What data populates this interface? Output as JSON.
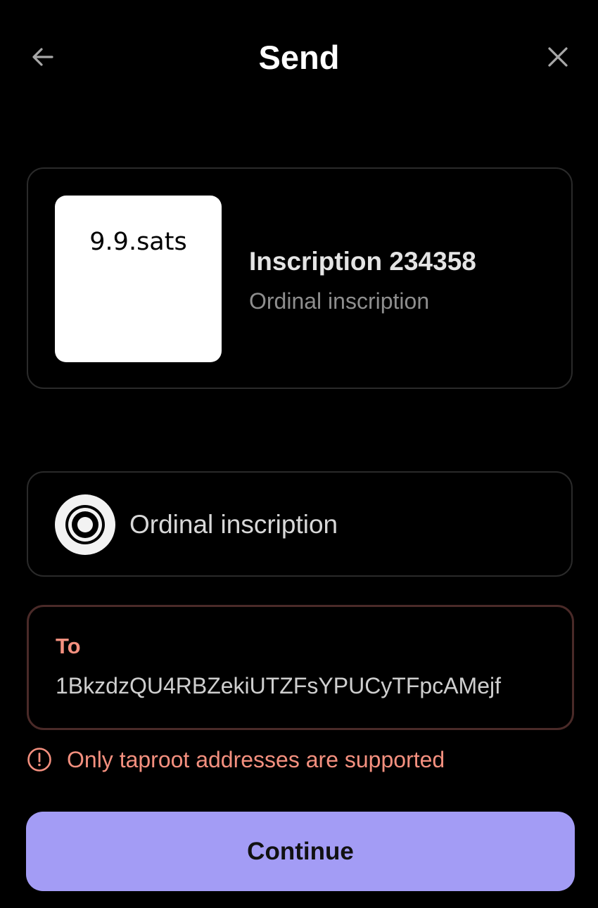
{
  "header": {
    "title": "Send",
    "back_icon": "arrow-left-icon",
    "close_icon": "close-icon"
  },
  "inscription": {
    "preview_text": "9.9.sats",
    "title": "Inscription 234358",
    "subtitle": "Ordinal inscription"
  },
  "asset_type": {
    "icon": "ordinal-icon",
    "label": "Ordinal inscription"
  },
  "recipient": {
    "label": "To",
    "value": "1BkzdzQU4RBZekiUTZFsYPUCyTFpcAMejf"
  },
  "error": {
    "icon": "error-circle-icon",
    "message": "Only taproot addresses are supported"
  },
  "actions": {
    "continue_label": "Continue"
  },
  "colors": {
    "background": "#000000",
    "error": "#f4907f",
    "primary_button": "#a39cf5",
    "border": "#2a2a2a",
    "error_border": "#4a2a28"
  }
}
